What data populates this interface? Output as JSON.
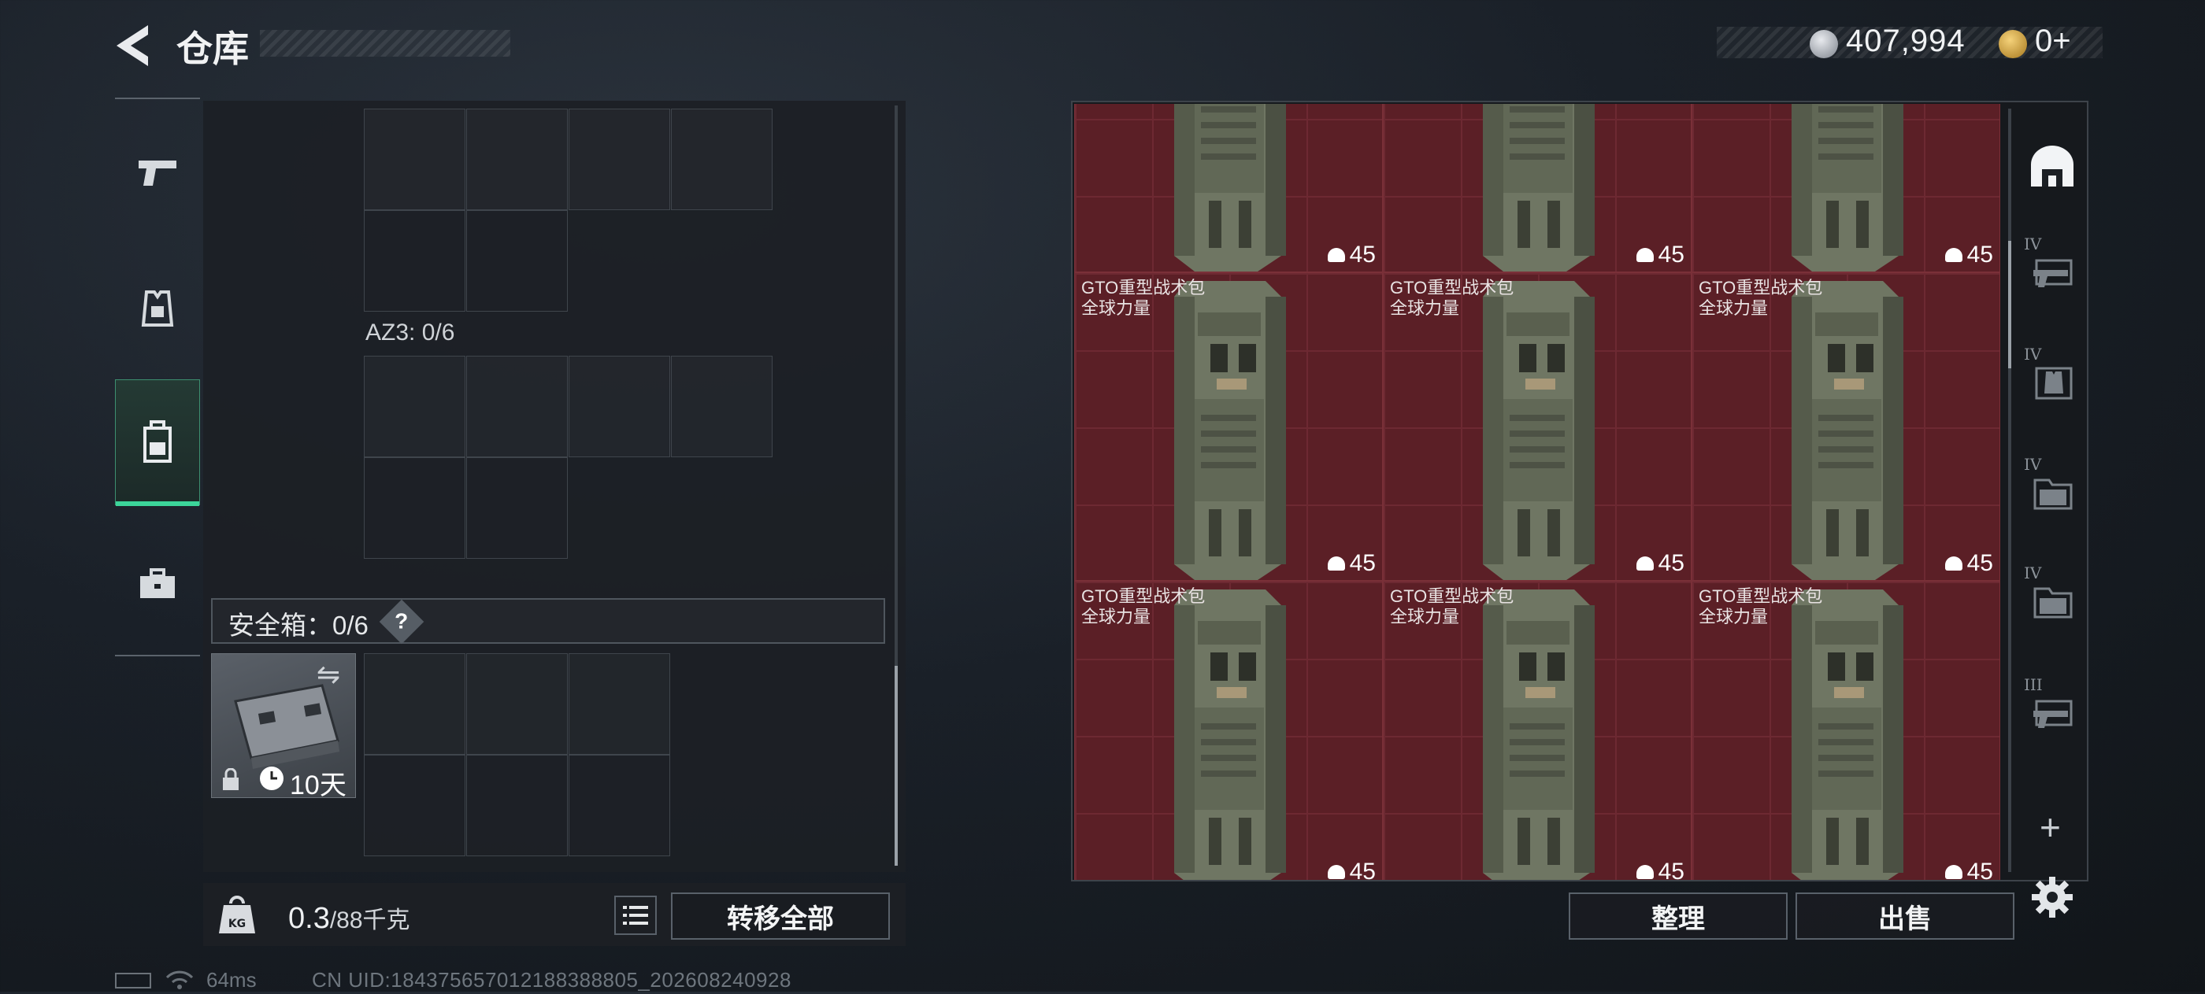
{
  "header": {
    "title": "仓库",
    "coins": "407,994",
    "tokens": "0+"
  },
  "left_rail": {
    "items": [
      {
        "name": "weapons",
        "icon": "pistol-icon"
      },
      {
        "name": "armor",
        "icon": "vest-icon"
      },
      {
        "name": "backpacks",
        "icon": "backpack-icon",
        "active": true
      },
      {
        "name": "cases",
        "icon": "case-icon"
      }
    ]
  },
  "inventory": {
    "az3_label": "AZ3: 0/6",
    "safe_label": "安全箱：0/6",
    "safe_help": "?",
    "safebox_duration": "10天",
    "weight_current": "0.3",
    "weight_max": "/88千克",
    "transfer_all_label": "转移全部"
  },
  "stash": {
    "item_name_line1": "GTO重型战术包",
    "item_name_line2": "全球力量",
    "item_count": "45",
    "sort_label": "整理",
    "sell_label": "出售",
    "tabs": [
      {
        "num": "",
        "icon": "stash-home-icon"
      },
      {
        "num": "IV",
        "icon": "gun-stash-icon"
      },
      {
        "num": "IV",
        "icon": "armor-stash-icon"
      },
      {
        "num": "IV",
        "icon": "folder-stash-icon"
      },
      {
        "num": "IV",
        "icon": "folder-stash-icon"
      },
      {
        "num": "III",
        "icon": "gun-stash-icon"
      }
    ],
    "add_label": "+"
  },
  "status": {
    "ping": "64ms",
    "uid": "CN UID:184375657012188388805_202608240928"
  },
  "colors": {
    "accent": "#3cd59a",
    "tile_bg": "#5b1f26",
    "panel_bg": "#1c2025"
  }
}
